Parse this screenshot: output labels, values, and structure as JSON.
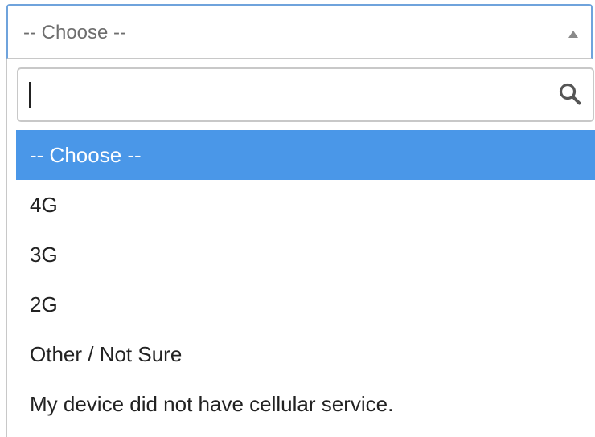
{
  "select": {
    "selected_value": "-- Choose --",
    "icon": "triangle-up-icon"
  },
  "search": {
    "value": "",
    "icon": "search-icon"
  },
  "options": [
    "-- Choose --",
    "4G",
    "3G",
    "2G",
    "Other / Not Sure",
    "My device did not have cellular service."
  ],
  "highlighted_index": 0,
  "colors": {
    "highlight": "#4a97e8",
    "focus_border": "#6fa3dc",
    "border": "#c8c8c8",
    "text": "#222222",
    "placeholder_text": "#6e6e6e"
  }
}
